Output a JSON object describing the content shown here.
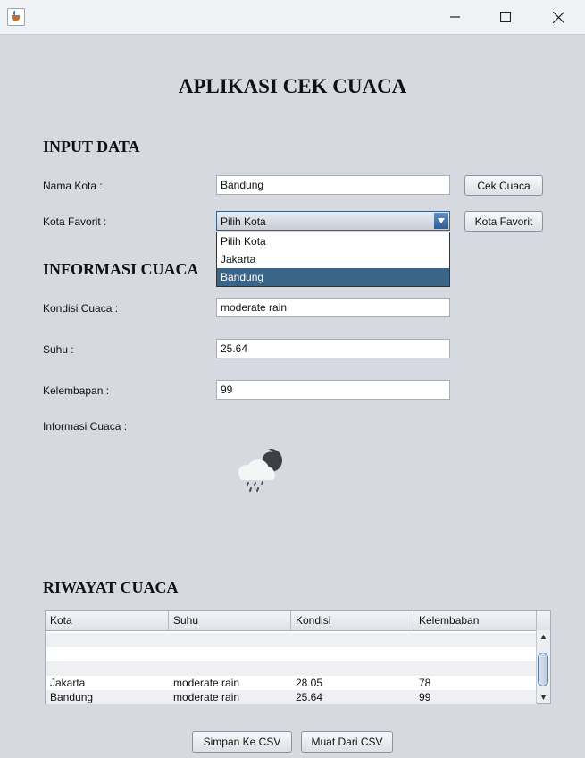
{
  "window": {
    "title": ""
  },
  "app_title": "APLIKASI CEK CUACA",
  "input_section": {
    "heading": "INPUT DATA",
    "city_label": "Nama Kota :",
    "city_value": "Bandung",
    "check_button": "Cek Cuaca",
    "favorite_label": "Kota Favorit :",
    "favorite_selected": "Pilih Kota",
    "favorite_button": "Kota Favorit",
    "favorite_options": [
      "Pilih Kota",
      "Jakarta",
      "Bandung"
    ],
    "favorite_highlighted": "Bandung"
  },
  "info_section": {
    "heading": "INFORMASI CUACA",
    "condition_label": "Kondisi Cuaca :",
    "condition_value": "moderate rain",
    "temp_label": "Suhu :",
    "temp_value": "25.64",
    "humidity_label": "Kelembapan :",
    "humidity_value": "99",
    "info_label": "Informasi Cuaca :",
    "weather_icon": "cloud-moon-rain-icon"
  },
  "history_section": {
    "heading": "RIWAYAT CUACA",
    "columns": [
      "Kota",
      "Suhu",
      "Kondisi",
      "Kelembaban"
    ],
    "rows": [
      [
        "",
        "",
        "",
        ""
      ],
      [
        "",
        "",
        "",
        ""
      ],
      [
        "",
        "",
        "",
        ""
      ],
      [
        "Jakarta",
        "moderate rain",
        "28.05",
        "78"
      ],
      [
        "Bandung",
        "moderate rain",
        "25.64",
        "99"
      ]
    ]
  },
  "footer": {
    "save_button": "Simpan Ke CSV",
    "load_button": "Muat Dari CSV"
  },
  "colors": {
    "background": "#d6d9e0",
    "selection": "#3a6488",
    "combo_arrow": "#2d5d92"
  }
}
